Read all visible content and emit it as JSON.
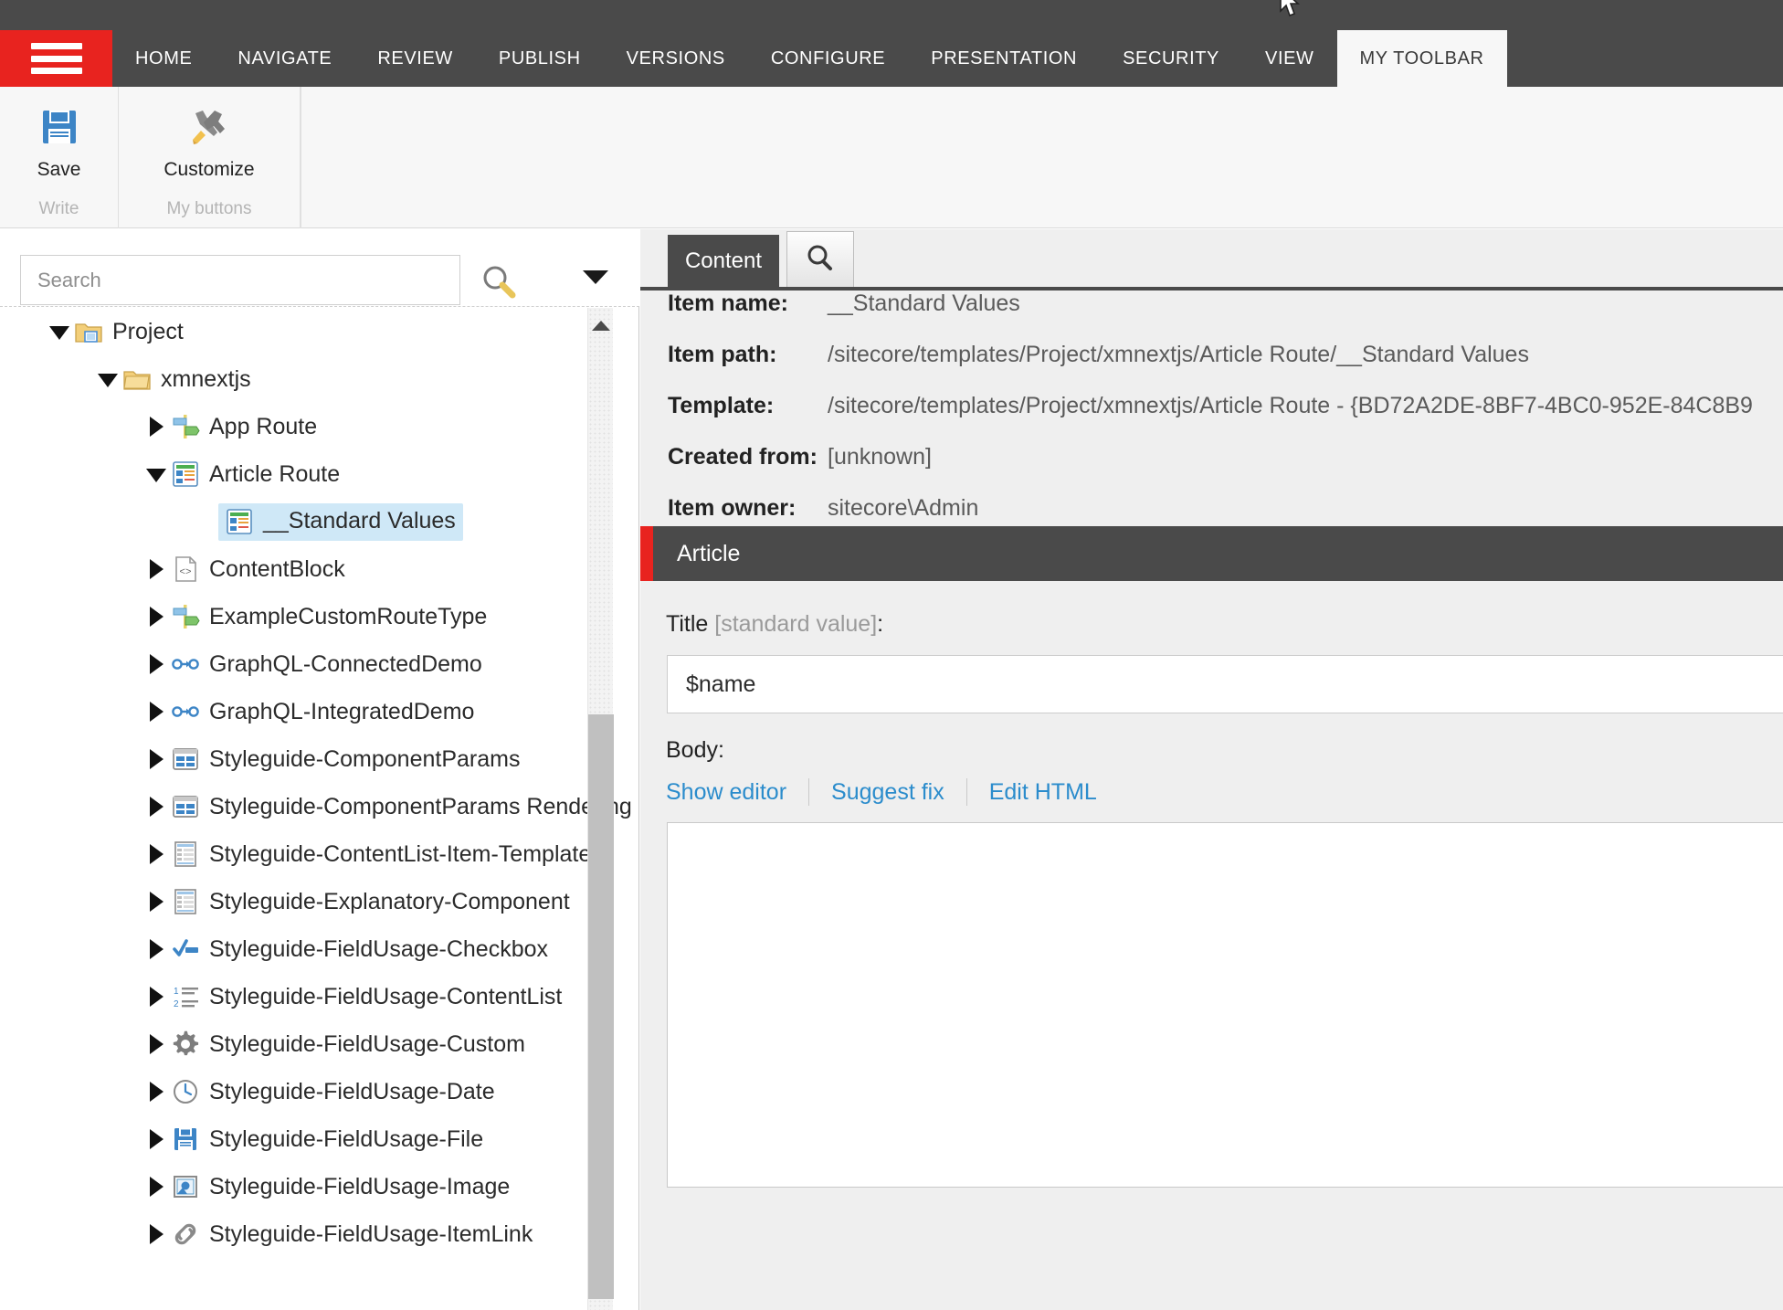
{
  "ribbon": {
    "menu_icon": "hamburger-icon",
    "tabs": [
      {
        "label": "HOME",
        "active": false
      },
      {
        "label": "NAVIGATE",
        "active": false
      },
      {
        "label": "REVIEW",
        "active": false
      },
      {
        "label": "PUBLISH",
        "active": false
      },
      {
        "label": "VERSIONS",
        "active": false
      },
      {
        "label": "CONFIGURE",
        "active": false
      },
      {
        "label": "PRESENTATION",
        "active": false
      },
      {
        "label": "SECURITY",
        "active": false
      },
      {
        "label": "VIEW",
        "active": false
      },
      {
        "label": "MY TOOLBAR",
        "active": true
      }
    ],
    "chunks": [
      {
        "button_label": "Save",
        "icon": "floppy-disk-icon",
        "group_label": "Write"
      },
      {
        "button_label": "Customize",
        "icon": "wrench-screwdriver-icon",
        "group_label": "My buttons"
      }
    ]
  },
  "tree_panel": {
    "search": {
      "placeholder": "Search",
      "value": "",
      "go_icon": "magnifier-icon",
      "options_icon": "chevron-down-icon"
    },
    "scrollbar": {
      "up_icon": "scroll-up-arrow-icon"
    },
    "items": [
      {
        "label": "Project",
        "depth": 1,
        "state": "open",
        "icon": "project-folder-icon",
        "selected": false
      },
      {
        "label": "xmnextjs",
        "depth": 2,
        "state": "open",
        "icon": "folder-icon",
        "selected": false
      },
      {
        "label": "App Route",
        "depth": 3,
        "state": "closed",
        "icon": "route-signpost-icon",
        "selected": false
      },
      {
        "label": "Article Route",
        "depth": 3,
        "state": "open",
        "icon": "template-icon",
        "selected": false
      },
      {
        "label": "__Standard Values",
        "depth": 4,
        "state": "none",
        "icon": "template-icon",
        "selected": true
      },
      {
        "label": "ContentBlock",
        "depth": 3,
        "state": "closed",
        "icon": "code-document-icon",
        "selected": false
      },
      {
        "label": "ExampleCustomRouteType",
        "depth": 3,
        "state": "closed",
        "icon": "route-signpost-icon",
        "selected": false
      },
      {
        "label": "GraphQL-ConnectedDemo",
        "depth": 3,
        "state": "closed",
        "icon": "node-link-icon",
        "selected": false
      },
      {
        "label": "GraphQL-IntegratedDemo",
        "depth": 3,
        "state": "closed",
        "icon": "node-link-icon",
        "selected": false
      },
      {
        "label": "Styleguide-ComponentParams",
        "depth": 3,
        "state": "closed",
        "icon": "component-params-icon",
        "selected": false
      },
      {
        "label": "Styleguide-ComponentParams Rendering",
        "depth": 3,
        "state": "closed",
        "icon": "component-params-icon",
        "selected": false
      },
      {
        "label": "Styleguide-ContentList-Item-Template",
        "depth": 3,
        "state": "closed",
        "icon": "list-template-icon",
        "selected": false
      },
      {
        "label": "Styleguide-Explanatory-Component",
        "depth": 3,
        "state": "closed",
        "icon": "list-template-icon",
        "selected": false
      },
      {
        "label": "Styleguide-FieldUsage-Checkbox",
        "depth": 3,
        "state": "closed",
        "icon": "checkbox-icon",
        "selected": false
      },
      {
        "label": "Styleguide-FieldUsage-ContentList",
        "depth": 3,
        "state": "closed",
        "icon": "numbered-list-icon",
        "selected": false
      },
      {
        "label": "Styleguide-FieldUsage-Custom",
        "depth": 3,
        "state": "closed",
        "icon": "gear-icon",
        "selected": false
      },
      {
        "label": "Styleguide-FieldUsage-Date",
        "depth": 3,
        "state": "closed",
        "icon": "clock-icon",
        "selected": false
      },
      {
        "label": "Styleguide-FieldUsage-File",
        "depth": 3,
        "state": "closed",
        "icon": "floppy-disk-icon",
        "selected": false
      },
      {
        "label": "Styleguide-FieldUsage-Image",
        "depth": 3,
        "state": "closed",
        "icon": "image-icon",
        "selected": false
      },
      {
        "label": "Styleguide-FieldUsage-ItemLink",
        "depth": 3,
        "state": "closed",
        "icon": "chain-link-icon",
        "selected": false
      }
    ]
  },
  "content": {
    "tabs": {
      "content_label": "Content",
      "search_icon": "magnifier-icon"
    },
    "meta": [
      {
        "key": "Item name:",
        "value": "__Standard Values"
      },
      {
        "key": "Item path:",
        "value": "/sitecore/templates/Project/xmnextjs/Article Route/__Standard Values"
      },
      {
        "key": "Template:",
        "value": "/sitecore/templates/Project/xmnextjs/Article Route - {BD72A2DE-8BF7-4BC0-952E-84C8B9"
      },
      {
        "key": "Created from:",
        "value": "[unknown]"
      },
      {
        "key": "Item owner:",
        "value": "sitecore\\Admin"
      }
    ],
    "section": {
      "title": "Article",
      "accent_color": "#e8231f"
    },
    "fields": {
      "title": {
        "label": "Title",
        "label_suffix": "[standard value]",
        "label_colon": ":",
        "value": "$name"
      },
      "body": {
        "label": "Body:",
        "links": [
          "Show editor",
          "Suggest fix",
          "Edit HTML"
        ],
        "value": ""
      }
    }
  }
}
